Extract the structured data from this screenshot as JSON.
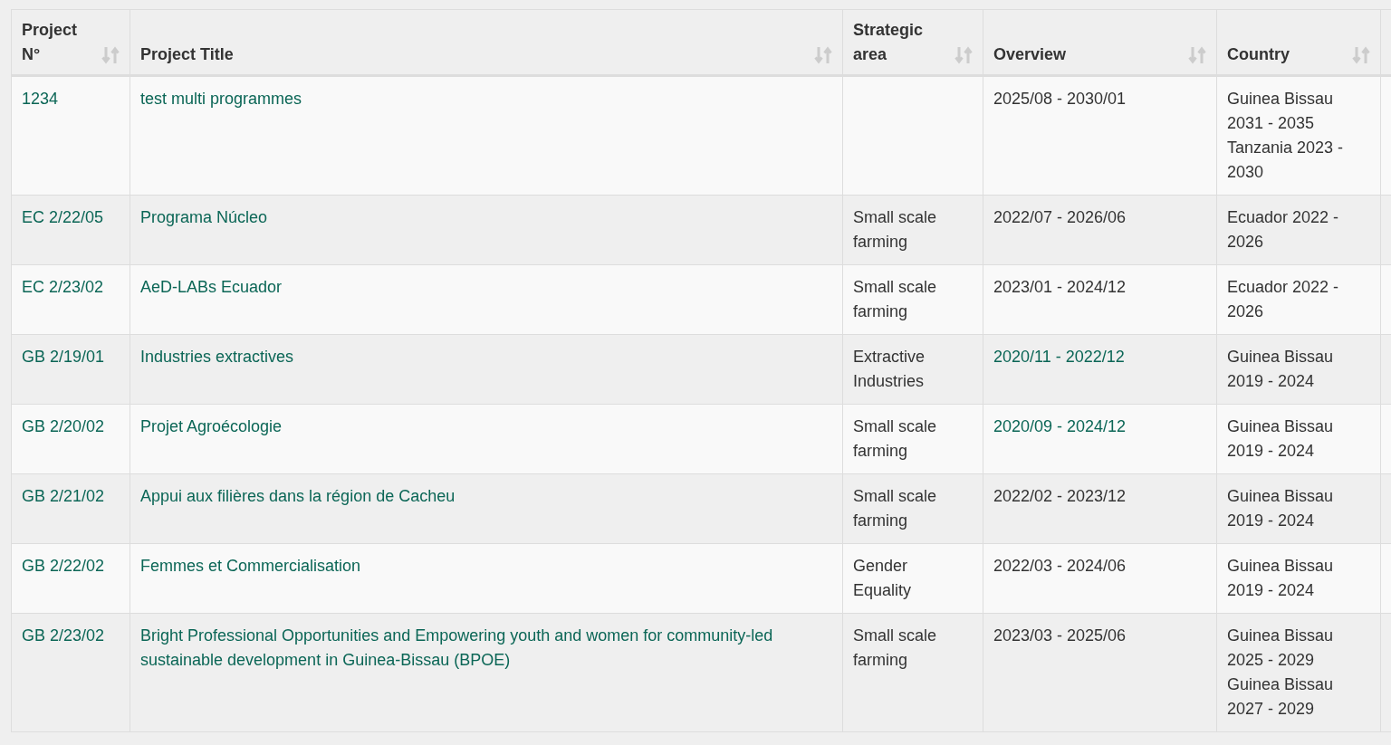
{
  "table": {
    "columns": [
      {
        "label": "Project N°",
        "sortable": true
      },
      {
        "label": "Project Title",
        "sortable": true
      },
      {
        "label": "Strategic area",
        "sortable": true
      },
      {
        "label": "Overview",
        "sortable": true
      },
      {
        "label": "Country",
        "sortable": true
      }
    ],
    "rows": [
      {
        "number": "1234",
        "title": "test multi programmes",
        "area": "",
        "overview": "2025/08 - 2030/01",
        "overview_link": false,
        "countries": [
          "Guinea Bissau 2031 - 2035",
          "Tanzania 2023 - 2030"
        ]
      },
      {
        "number": "EC 2/22/05",
        "title": "Programa Núcleo",
        "area": "Small scale farming",
        "overview": "2022/07 - 2026/06",
        "overview_link": false,
        "countries": [
          "Ecuador 2022 - 2026"
        ]
      },
      {
        "number": "EC 2/23/02",
        "title": "AeD-LABs Ecuador",
        "area": "Small scale farming",
        "overview": "2023/01 - 2024/12",
        "overview_link": false,
        "countries": [
          "Ecuador 2022 - 2026"
        ]
      },
      {
        "number": "GB 2/19/01",
        "title": "Industries extractives",
        "area": "Extractive Industries",
        "overview": "2020/11 - 2022/12",
        "overview_link": true,
        "countries": [
          "Guinea Bissau 2019 - 2024"
        ]
      },
      {
        "number": "GB 2/20/02",
        "title": "Projet Agroécologie",
        "area": "Small scale farming",
        "overview": "2020/09 - 2024/12",
        "overview_link": true,
        "countries": [
          "Guinea Bissau 2019 - 2024"
        ]
      },
      {
        "number": "GB 2/21/02",
        "title": "Appui aux filières dans la région de Cacheu",
        "area": "Small scale farming",
        "overview": "2022/02 - 2023/12",
        "overview_link": false,
        "countries": [
          "Guinea Bissau 2019 - 2024"
        ]
      },
      {
        "number": "GB 2/22/02",
        "title": "Femmes et Commercialisation",
        "area": "Gender Equality",
        "overview": "2022/03 - 2024/06",
        "overview_link": false,
        "countries": [
          "Guinea Bissau 2019 - 2024"
        ]
      },
      {
        "number": "GB 2/23/02",
        "title": "Bright Professional Opportunities and Empowering youth and women for community-led sustainable development in Guinea-Bissau (BPOE)",
        "area": "Small scale farming",
        "overview": "2023/03 - 2025/06",
        "overview_link": false,
        "countries": [
          "Guinea Bissau 2025 - 2029",
          "Guinea Bissau 2027 - 2029"
        ]
      }
    ]
  }
}
